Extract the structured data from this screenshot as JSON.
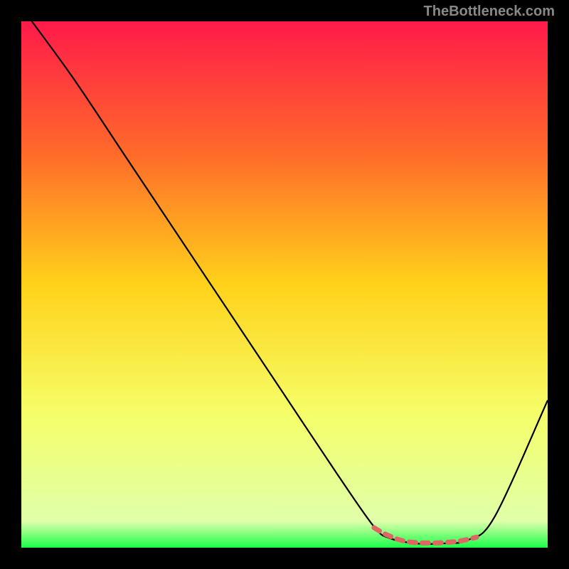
{
  "watermark": "TheBottleneck.com",
  "chart_data": {
    "type": "line",
    "title": "",
    "xlabel": "",
    "ylabel": "",
    "xlim": [
      0,
      100
    ],
    "ylim": [
      0,
      100
    ],
    "series": [
      {
        "name": "curve",
        "x": [
          2,
          10,
          20,
          30,
          40,
          50,
          60,
          67,
          70,
          75,
          80,
          85,
          90,
          100
        ],
        "y": [
          100,
          89,
          74,
          59,
          44,
          29,
          14,
          4,
          1.8,
          0.8,
          0.8,
          1.5,
          6,
          28
        ]
      }
    ],
    "highlight": {
      "name": "red-dash",
      "x": [
        67,
        68.5,
        70,
        71.5,
        73,
        74.5,
        76,
        77.5,
        79,
        80.5,
        82,
        83.5,
        85,
        86.5
      ],
      "y": [
        3.8,
        2.9,
        2.2,
        1.6,
        1.2,
        1.0,
        0.9,
        0.9,
        0.9,
        1.0,
        1.1,
        1.3,
        1.6,
        2.0
      ]
    },
    "gradient": {
      "stops": [
        {
          "offset": 0,
          "color": "#ff1a4a"
        },
        {
          "offset": 25,
          "color": "#ff6a2a"
        },
        {
          "offset": 50,
          "color": "#ffd21a"
        },
        {
          "offset": 75,
          "color": "#f5ff6a"
        },
        {
          "offset": 95,
          "color": "#dfffaa"
        },
        {
          "offset": 100,
          "color": "#1aff4a"
        }
      ]
    }
  }
}
